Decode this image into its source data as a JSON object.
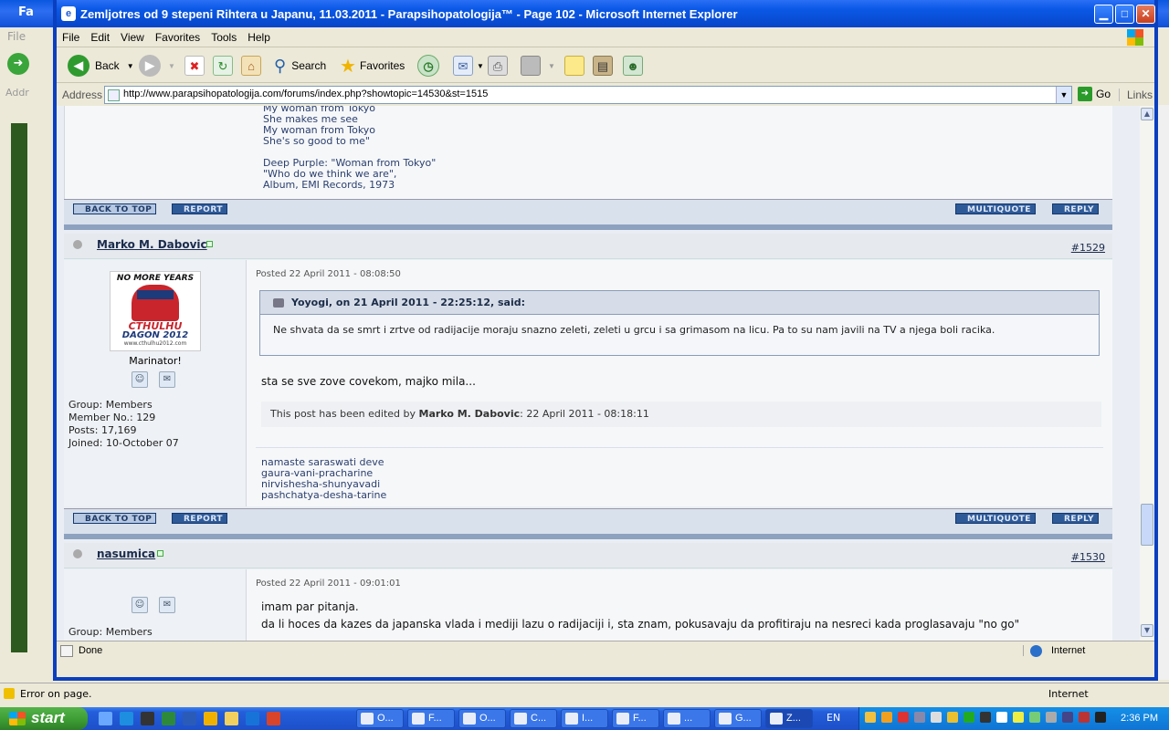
{
  "background_window": {
    "title": "Fa",
    "menu_label": "File",
    "address_label": "Addr",
    "status_text": "Error on page.",
    "zone": "Internet"
  },
  "window": {
    "title": "Zemljotres od 9 stepeni Rihtera u Japanu, 11.03.2011 - Parapsihopatologija™ - Page 102 - Microsoft Internet Explorer",
    "menu": [
      "File",
      "Edit",
      "View",
      "Favorites",
      "Tools",
      "Help"
    ],
    "toolbar": {
      "back": "Back",
      "search": "Search",
      "favorites": "Favorites"
    },
    "address_label": "Address",
    "url": "http://www.parapsihopatologija.com/forums/index.php?showtopic=14530&st=1515",
    "go": "Go",
    "links": "Links",
    "status_text": "Done",
    "zone": "Internet"
  },
  "forum": {
    "top_signature": [
      "My woman from Tokyo",
      "She makes me see",
      "My woman from Tokyo",
      "She's so good to me\"",
      "",
      "Deep Purple: \"Woman from Tokyo\"",
      "\"Who do we think we are\",",
      "Album, EMI Records, 1973"
    ],
    "buttons": {
      "back_to_top": "BACK TO TOP",
      "report": "REPORT",
      "multiquote": "MULTIQUOTE",
      "reply": "REPLY"
    },
    "posts": [
      {
        "author": "Marko M. Dabovic",
        "number": "#1529",
        "avatar_lines": [
          "NO MORE YEARS",
          "CTHULHU",
          "DAGON 2012",
          "www.cthulhu2012.com"
        ],
        "member_title": "Marinator!",
        "group_label": "Group:",
        "group": "Members",
        "member_no_label": "Member No.:",
        "member_no": "129",
        "posts_label": "Posts:",
        "posts": "17,169",
        "joined_label": "Joined:",
        "joined": "10-October 07",
        "posted": "Posted 22 April 2011 - 08:08:50",
        "quote_header": "Yoyogi, on 21 April 2011 - 22:25:12, said:",
        "quote_body": "Ne shvata da se smrt i zrtve od radijacije moraju snazno zeleti, zeleti u grcu i sa grimasom na licu. Pa to su nam javili na TV a njega boli racika.",
        "body": "sta se sve zove covekom, majko mila...",
        "edited_prefix": "This post has been edited by",
        "edited_by": "Marko M. Dabovic",
        "edited_at": ": 22 April 2011 - 08:18:11",
        "signature": [
          " namaste saraswati deve",
          "gaura-vani-pracharine",
          "nirvishesha-shunyavadi",
          "pashchatya-desha-tarine"
        ]
      },
      {
        "author": "nasumica",
        "number": "#1530",
        "group_label": "Group:",
        "group": "Members",
        "posted": "Posted 22 April 2011 - 09:01:01",
        "body_lines": [
          "imam par pitanja.",
          "da li hoces da kazes da japanska vlada i mediji lazu o radijaciji i, sta znam, pokusavaju da profitiraju na nesreci kada proglasavaju \"no go\""
        ]
      }
    ]
  },
  "taskbar": {
    "start": "start",
    "tasks": [
      "O...",
      "F...",
      "O...",
      "C...",
      "I...",
      "F...",
      "...",
      "G...",
      "Z..."
    ],
    "language": "EN",
    "clock": "2:36 PM"
  },
  "colors": {
    "title_blue": "#0a58e6",
    "forum_bar": "#d9e1ec",
    "forum_button": "#2f5a98",
    "start_green": "#3c9a33"
  }
}
